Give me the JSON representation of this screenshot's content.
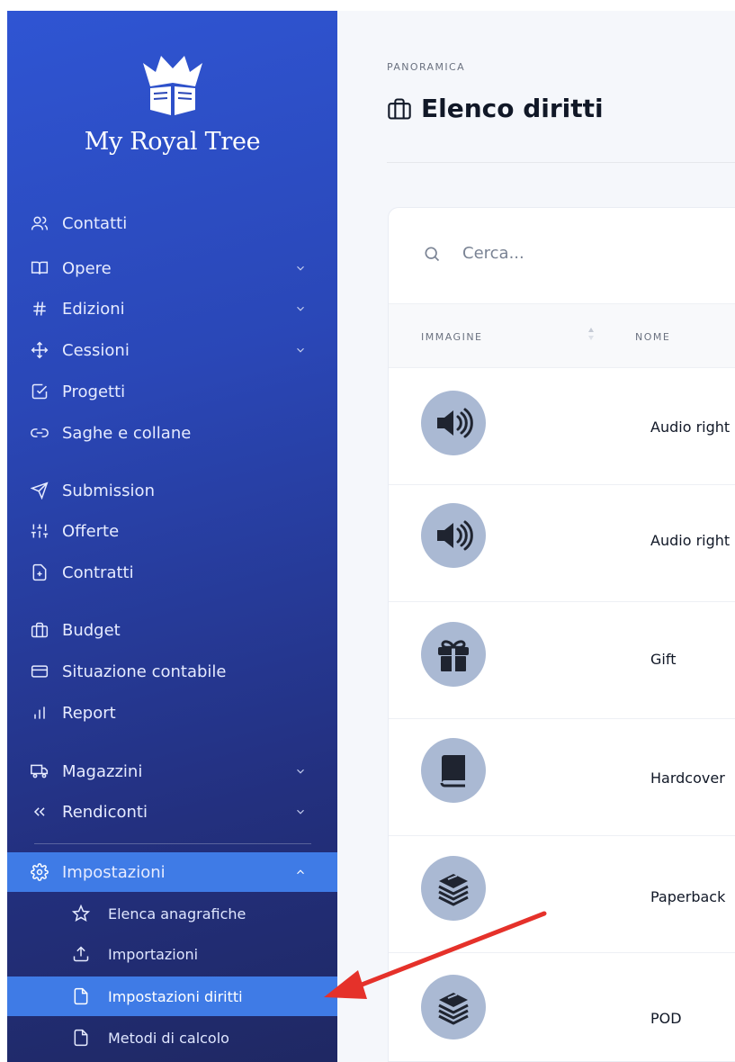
{
  "brand": {
    "name": "My Royal Tree",
    "logo_icon": "crown-book-icon"
  },
  "sidebar": {
    "items": [
      {
        "label": "Contatti",
        "icon": "users-icon"
      },
      {
        "label": "Opere",
        "icon": "book-open-icon",
        "expandable": true
      },
      {
        "label": "Edizioni",
        "icon": "hash-icon",
        "expandable": true
      },
      {
        "label": "Cessioni",
        "icon": "move-icon",
        "expandable": true
      },
      {
        "label": "Progetti",
        "icon": "checkbox-icon"
      },
      {
        "label": "Saghe e collane",
        "icon": "link-icon"
      },
      {
        "label": "Submission",
        "icon": "send-icon"
      },
      {
        "label": "Offerte",
        "icon": "sliders-icon"
      },
      {
        "label": "Contratti",
        "icon": "file-plus-icon"
      },
      {
        "label": "Budget",
        "icon": "briefcase-icon"
      },
      {
        "label": "Situazione contabile",
        "icon": "credit-card-icon"
      },
      {
        "label": "Report",
        "icon": "bar-chart-icon"
      },
      {
        "label": "Magazzini",
        "icon": "truck-icon",
        "expandable": true
      },
      {
        "label": "Rendiconti",
        "icon": "chevrons-left-icon",
        "expandable": true
      },
      {
        "label": "Impostazioni",
        "icon": "gear-icon",
        "expanded": true,
        "active": true
      }
    ],
    "subitems": [
      {
        "label": "Elenca anagrafiche",
        "icon": "star-icon"
      },
      {
        "label": "Importazioni",
        "icon": "upload-icon"
      },
      {
        "label": "Impostazioni diritti",
        "icon": "file-icon",
        "active": true
      },
      {
        "label": "Metodi di calcolo",
        "icon": "file-icon"
      }
    ]
  },
  "page": {
    "breadcrumb": "PANORAMICA",
    "title": "Elenco diritti",
    "title_icon": "briefcase-icon"
  },
  "search": {
    "placeholder": "Cerca..."
  },
  "table": {
    "columns": [
      "IMMAGINE",
      "NOME"
    ],
    "rows": [
      {
        "name": "Audio right",
        "icon": "speaker-icon"
      },
      {
        "name": "Audio right",
        "icon": "speaker-icon"
      },
      {
        "name": "Gift",
        "icon": "gift-icon"
      },
      {
        "name": "Hardcover",
        "icon": "book-icon"
      },
      {
        "name": "Paperback",
        "icon": "book-stack-icon"
      },
      {
        "name": "POD",
        "icon": "book-stack-icon"
      }
    ]
  },
  "colors": {
    "sidebar_top": "#2f55d3",
    "sidebar_bottom": "#1f2863",
    "active": "#3f7be6",
    "annotation_arrow": "#e5312a",
    "avatar_bg": "#aab9d3"
  }
}
